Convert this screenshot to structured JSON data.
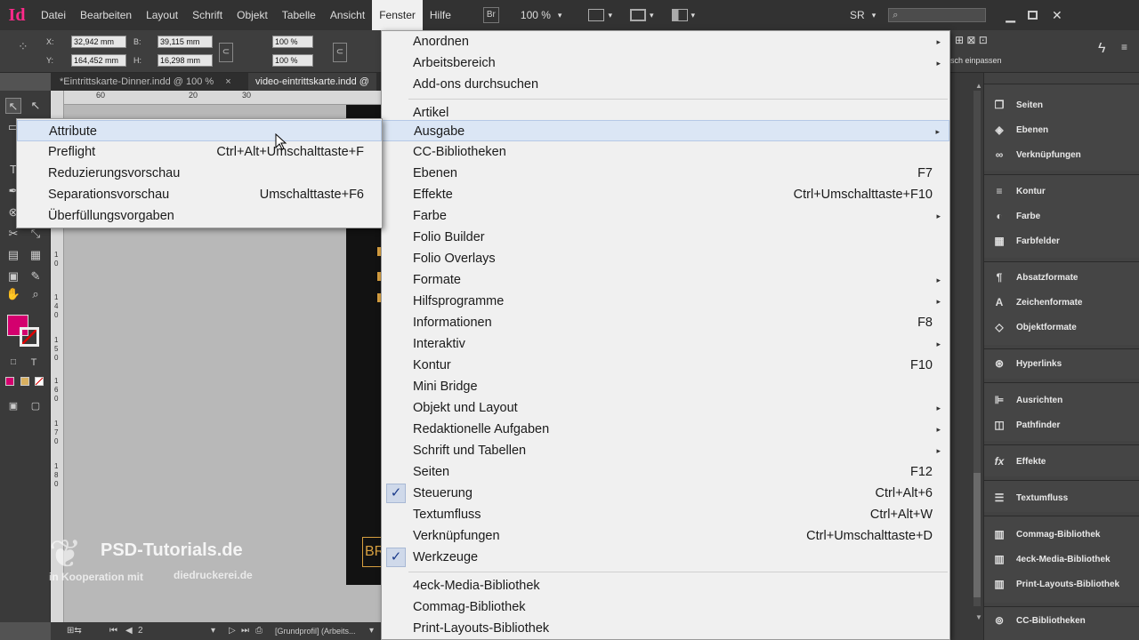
{
  "menubar": {
    "logo": "Id",
    "items": [
      "Datei",
      "Bearbeiten",
      "Layout",
      "Schrift",
      "Objekt",
      "Tabelle",
      "Ansicht",
      "Fenster",
      "Hilfe"
    ],
    "br_label": "Br",
    "zoom": "100 %",
    "workspace": "SR"
  },
  "control": {
    "x_label": "X:",
    "x_value": "32,942 mm",
    "y_label": "Y:",
    "y_value": "164,452 mm",
    "w_label": "B:",
    "w_value": "39,115 mm",
    "h_label": "H:",
    "h_value": "16,298 mm",
    "scale_x": "100 %",
    "scale_y": "100 %",
    "fit_label": "sch einpassen"
  },
  "tabs": [
    {
      "label": "*Eintrittskarte-Dinner.indd @ 100 %"
    },
    {
      "label": "video-eintrittskarte.indd @"
    }
  ],
  "ruler": {
    "h_ticks": [
      "60",
      "20",
      "30"
    ],
    "v_ticks": [
      "1",
      "0",
      "1",
      "4",
      "0",
      "1",
      "5",
      "0",
      "1",
      "6",
      "0",
      "1",
      "7",
      "0",
      "1",
      "8",
      "0"
    ]
  },
  "status": {
    "page": "2",
    "profile": "[Grundprofil] (Arbeits..."
  },
  "fenster_menu": {
    "group1": [
      {
        "label": "Anordnen",
        "arrow": "▸"
      },
      {
        "label": "Arbeitsbereich",
        "arrow": "▸"
      },
      {
        "label": "Add-ons durchsuchen"
      }
    ],
    "group2": [
      {
        "label": "Artikel"
      },
      {
        "label": "Ausgabe",
        "arrow": "▸",
        "highlighted": true
      },
      {
        "label": "CC-Bibliotheken"
      },
      {
        "label": "Ebenen",
        "shortcut": "F7"
      },
      {
        "label": "Effekte",
        "shortcut": "Ctrl+Umschalttaste+F10"
      },
      {
        "label": "Farbe",
        "arrow": "▸"
      },
      {
        "label": "Folio Builder"
      },
      {
        "label": "Folio Overlays"
      },
      {
        "label": "Formate",
        "arrow": "▸"
      },
      {
        "label": "Hilfsprogramme",
        "arrow": "▸"
      },
      {
        "label": "Informationen",
        "shortcut": "F8"
      },
      {
        "label": "Interaktiv",
        "arrow": "▸"
      },
      {
        "label": "Kontur",
        "shortcut": "F10"
      },
      {
        "label": "Mini Bridge"
      },
      {
        "label": "Objekt und Layout",
        "arrow": "▸"
      },
      {
        "label": "Redaktionelle Aufgaben",
        "arrow": "▸"
      },
      {
        "label": "Schrift und Tabellen",
        "arrow": "▸"
      },
      {
        "label": "Seiten",
        "shortcut": "F12"
      },
      {
        "label": "Steuerung",
        "shortcut": "Ctrl+Alt+6",
        "checked": "✓"
      },
      {
        "label": "Textumfluss",
        "shortcut": "Ctrl+Alt+W"
      },
      {
        "label": "Verknüpfungen",
        "shortcut": "Ctrl+Umschalttaste+D"
      },
      {
        "label": "Werkzeuge",
        "checked": "✓"
      }
    ],
    "group3": [
      {
        "label": "4eck-Media-Bibliothek"
      },
      {
        "label": "Commag-Bibliothek"
      },
      {
        "label": "Print-Layouts-Bibliothek"
      }
    ]
  },
  "ausgabe_submenu": [
    {
      "label": "Attribute"
    },
    {
      "label": "Preflight",
      "shortcut": "Ctrl+Alt+Umschalttaste+F"
    },
    {
      "label": "Reduzierungsvorschau"
    },
    {
      "label": "Separationsvorschau",
      "shortcut": "Umschalttaste+F6"
    },
    {
      "label": "Überfüllungsvorgaben"
    }
  ],
  "panels": [
    {
      "label": "Seiten",
      "icon": "pages-icon"
    },
    {
      "label": "Ebenen",
      "icon": "layers-icon"
    },
    {
      "label": "Verknüpfungen",
      "icon": "links-icon"
    },
    {
      "label": "Kontur",
      "icon": "stroke-icon"
    },
    {
      "label": "Farbe",
      "icon": "color-icon"
    },
    {
      "label": "Farbfelder",
      "icon": "swatches-icon"
    },
    {
      "label": "Absatzformate",
      "icon": "paragraph-styles-icon"
    },
    {
      "label": "Zeichenformate",
      "icon": "character-styles-icon"
    },
    {
      "label": "Objektformate",
      "icon": "object-styles-icon"
    },
    {
      "label": "Hyperlinks",
      "icon": "hyperlinks-icon"
    },
    {
      "label": "Ausrichten",
      "icon": "align-icon"
    },
    {
      "label": "Pathfinder",
      "icon": "pathfinder-icon"
    },
    {
      "label": "Effekte",
      "icon": "effects-icon"
    },
    {
      "label": "Textumfluss",
      "icon": "text-wrap-icon"
    },
    {
      "label": "Commag-Bibliothek",
      "icon": "library-icon"
    },
    {
      "label": "4eck-Media-Bibliothek",
      "icon": "library-icon"
    },
    {
      "label": "Print-Layouts-Bibliothek",
      "icon": "library-icon"
    },
    {
      "label": "CC-Bibliotheken",
      "icon": "cc-libraries-icon"
    }
  ],
  "watermark": {
    "brand": "PSD-Tutorials.de",
    "coop": "in Kooperation mit",
    "partner": "diedruckerei.de"
  },
  "page_text": "BR",
  "colors": {
    "accent": "#d4006e",
    "menu_bg": "#f0f0f0",
    "highlight": "#dbe6f5",
    "app_bg": "#323232"
  }
}
